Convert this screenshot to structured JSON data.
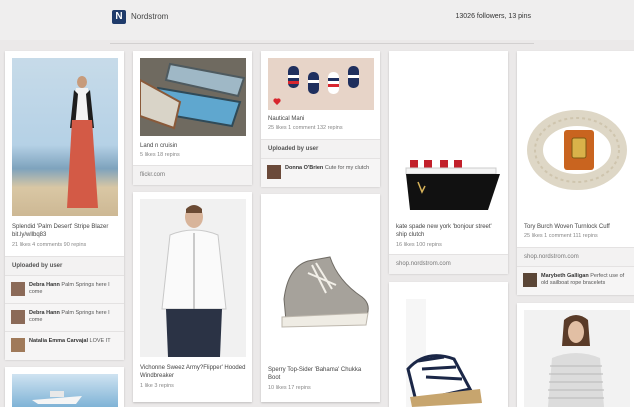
{
  "header": {
    "logo_letter": "N",
    "board_name": "Nordstrom",
    "stats": "13026 followers, 13 pins"
  },
  "pins": {
    "p1": {
      "desc": "Splendid 'Palm Desert' Stripe Blazer bit.ly/wllbq83",
      "meta": "21 likes  4 comments  90 repins",
      "section": "Uploaded by user",
      "comments": [
        {
          "name": "Debra Hann",
          "text": "Palm Springs here I come"
        },
        {
          "name": "Debra Hann",
          "text": "Palm Springs here I come"
        },
        {
          "name": "Natalia Emma Carvajal",
          "text": "LOVE IT"
        }
      ]
    },
    "p2": {
      "desc": "Land n cruisin",
      "meta": "5 likes  18 repins",
      "source": "flickr.com"
    },
    "p3": {
      "desc": "Vichonne Sweez Army?Flipper' Hooded Windbreaker",
      "meta": "1 like  3 repins"
    },
    "p4": {
      "desc": "Nautical Mani",
      "meta": "25 likes  1 comment  132 repins",
      "section": "Uploaded by user",
      "comment": {
        "name": "Donna O'Brien",
        "text": "Cute for my clutch"
      }
    },
    "p5": {
      "desc": "Sperry Top-Sider 'Bahama' Chukka Boot",
      "meta": "10 likes  17 repins"
    },
    "p6": {
      "desc": "kate spade new york 'bonjour street' ship clutch",
      "meta": "16 likes  100 repins",
      "source": "shop.nordstrom.com"
    },
    "p7": {
      "desc": "Tory Burch Woven Turnlock Cuff",
      "meta": "25 likes  1 comment  111 repins",
      "source": "shop.nordstrom.com",
      "comment": {
        "name": "Marybeth Galligan",
        "text": "Perfect use of old sailboat rope bracelets"
      }
    }
  },
  "colors": {
    "background": "#ebe9e9",
    "card": "#ffffff",
    "logo": "#1f3b6b"
  }
}
